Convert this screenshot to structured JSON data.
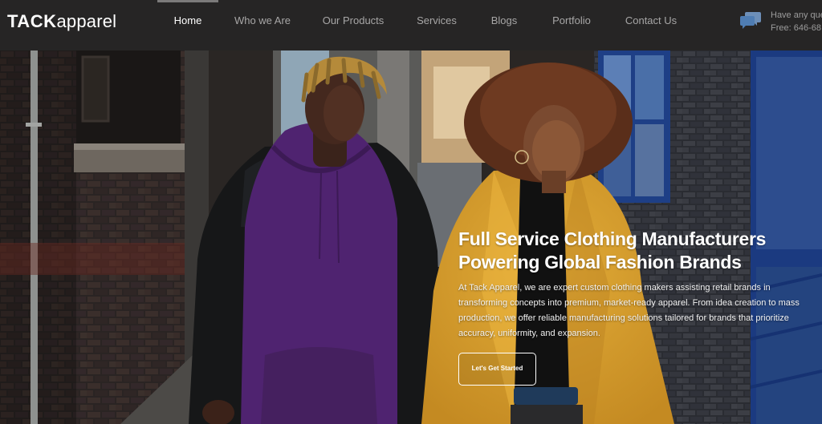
{
  "header": {
    "logo": {
      "brand": "TACK",
      "suffix": "apparel"
    },
    "nav": [
      {
        "label": "Home",
        "active": true
      },
      {
        "label": "Who we Are",
        "active": false
      },
      {
        "label": "Our Products",
        "active": false
      },
      {
        "label": "Services",
        "active": false
      },
      {
        "label": "Blogs",
        "active": false
      },
      {
        "label": "Portfolio",
        "active": false
      },
      {
        "label": "Contact Us",
        "active": false
      }
    ],
    "contact": {
      "icon": "chat-icon",
      "line1": "Have any que",
      "line2": "Free: 646-68"
    }
  },
  "hero": {
    "title_line1": "Full Service Clothing Manufacturers",
    "title_line2": "Powering Global Fashion Brands",
    "description": "At Tack Apparel, we are expert custom clothing makers assisting retail brands in transforming concepts into premium, market-ready apparel. From idea creation to mass production, we offer reliable manufacturing solutions tailored for brands that prioritize accuracy, uniformity, and expansion.",
    "cta_label": "Let's Get Started"
  },
  "colors": {
    "header_bg": "#262525",
    "nav_active": "#ffffff",
    "nav_inactive": "#a7a6a6",
    "hoodie_purple": "#4f2370",
    "coat_yellow": "#d7a02c",
    "window_blue": "#1e3f86"
  }
}
